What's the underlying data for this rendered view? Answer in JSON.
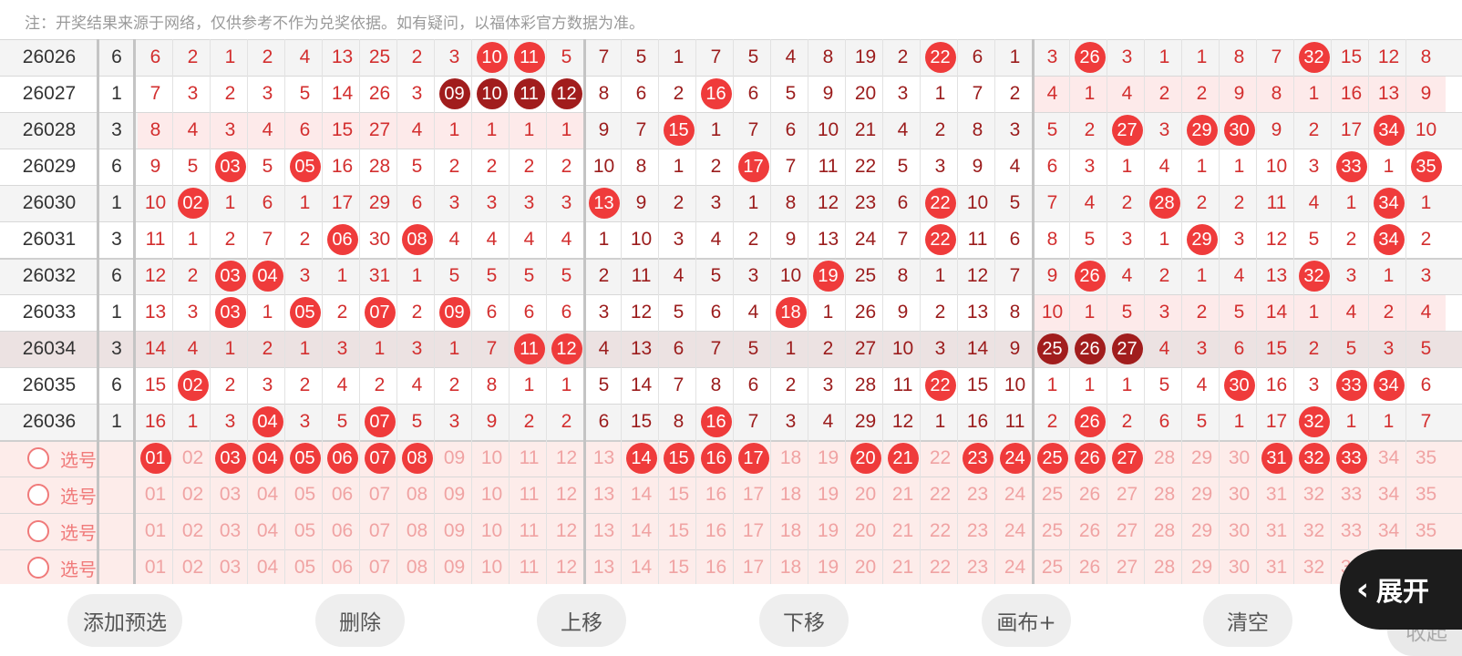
{
  "note": "注：开奖结果来源于网络，仅供参考不作为兑奖依据。如有疑问，以福体彩官方数据为准。",
  "rows": [
    {
      "issue": "26026",
      "sum": "6",
      "cells": [
        "6",
        "2",
        "1",
        "2",
        "4",
        "13",
        "25",
        "2",
        "3",
        "10",
        "11",
        "5",
        "7",
        "5",
        "1",
        "7",
        "5",
        "4",
        "8",
        "19",
        "2",
        "22",
        "6",
        "1",
        "3",
        "26",
        "3",
        "1",
        "1",
        "8",
        "7",
        "32",
        "15",
        "12",
        "8"
      ],
      "balls": [
        9,
        10,
        21,
        25,
        31
      ],
      "dark": []
    },
    {
      "issue": "26027",
      "sum": "1",
      "cells": [
        "7",
        "3",
        "2",
        "3",
        "5",
        "14",
        "26",
        "3",
        "09",
        "10",
        "11",
        "12",
        "8",
        "6",
        "2",
        "16",
        "6",
        "5",
        "9",
        "20",
        "3",
        "1",
        "7",
        "2",
        "4",
        "1",
        "4",
        "2",
        "2",
        "9",
        "8",
        "1",
        "16",
        "13",
        "9"
      ],
      "balls": [
        8,
        9,
        10,
        11,
        15
      ],
      "dark": [
        8,
        9,
        10,
        11
      ]
    },
    {
      "issue": "26028",
      "sum": "3",
      "cells": [
        "8",
        "4",
        "3",
        "4",
        "6",
        "15",
        "27",
        "4",
        "1",
        "1",
        "1",
        "1",
        "9",
        "7",
        "15",
        "1",
        "7",
        "6",
        "10",
        "21",
        "4",
        "2",
        "8",
        "3",
        "5",
        "2",
        "27",
        "3",
        "29",
        "30",
        "9",
        "2",
        "17",
        "34",
        "10"
      ],
      "balls": [
        14,
        26,
        28,
        29,
        33
      ],
      "dark": []
    },
    {
      "issue": "26029",
      "sum": "6",
      "cells": [
        "9",
        "5",
        "03",
        "5",
        "05",
        "16",
        "28",
        "5",
        "2",
        "2",
        "2",
        "2",
        "10",
        "8",
        "1",
        "2",
        "17",
        "7",
        "11",
        "22",
        "5",
        "3",
        "9",
        "4",
        "6",
        "3",
        "1",
        "4",
        "1",
        "1",
        "10",
        "3",
        "33",
        "1",
        "35"
      ],
      "balls": [
        2,
        4,
        16,
        32,
        34
      ],
      "dark": []
    },
    {
      "issue": "26030",
      "sum": "1",
      "cells": [
        "10",
        "02",
        "1",
        "6",
        "1",
        "17",
        "29",
        "6",
        "3",
        "3",
        "3",
        "3",
        "13",
        "9",
        "2",
        "3",
        "1",
        "8",
        "12",
        "23",
        "6",
        "22",
        "10",
        "5",
        "7",
        "4",
        "2",
        "28",
        "2",
        "2",
        "11",
        "4",
        "1",
        "34",
        "1"
      ],
      "balls": [
        1,
        12,
        21,
        27,
        33
      ],
      "dark": []
    },
    {
      "issue": "26031",
      "sum": "3",
      "cells": [
        "11",
        "1",
        "2",
        "7",
        "2",
        "06",
        "30",
        "08",
        "4",
        "4",
        "4",
        "4",
        "1",
        "10",
        "3",
        "4",
        "2",
        "9",
        "13",
        "24",
        "7",
        "22",
        "11",
        "6",
        "8",
        "5",
        "3",
        "1",
        "29",
        "3",
        "12",
        "5",
        "2",
        "34",
        "2"
      ],
      "balls": [
        5,
        7,
        21,
        28,
        33
      ],
      "dark": []
    },
    {
      "issue": "26032",
      "sum": "6",
      "cells": [
        "12",
        "2",
        "03",
        "04",
        "3",
        "1",
        "31",
        "1",
        "5",
        "5",
        "5",
        "5",
        "2",
        "11",
        "4",
        "5",
        "3",
        "10",
        "19",
        "25",
        "8",
        "1",
        "12",
        "7",
        "9",
        "26",
        "4",
        "2",
        "1",
        "4",
        "13",
        "32",
        "3",
        "1",
        "3"
      ],
      "balls": [
        2,
        3,
        18,
        25,
        31
      ],
      "dark": []
    },
    {
      "issue": "26033",
      "sum": "1",
      "cells": [
        "13",
        "3",
        "03",
        "1",
        "05",
        "2",
        "07",
        "2",
        "09",
        "6",
        "6",
        "6",
        "3",
        "12",
        "5",
        "6",
        "4",
        "18",
        "1",
        "26",
        "9",
        "2",
        "13",
        "8",
        "10",
        "1",
        "5",
        "3",
        "2",
        "5",
        "14",
        "1",
        "4",
        "2",
        "4"
      ],
      "balls": [
        2,
        4,
        6,
        8,
        17
      ],
      "dark": []
    },
    {
      "issue": "26034",
      "sum": "3",
      "cells": [
        "14",
        "4",
        "1",
        "2",
        "1",
        "3",
        "1",
        "3",
        "1",
        "7",
        "11",
        "12",
        "4",
        "13",
        "6",
        "7",
        "5",
        "1",
        "2",
        "27",
        "10",
        "3",
        "14",
        "9",
        "25",
        "26",
        "27",
        "4",
        "3",
        "6",
        "15",
        "2",
        "5",
        "3",
        "5"
      ],
      "balls": [
        10,
        11,
        24,
        25,
        26
      ],
      "dark": [
        24,
        25,
        26
      ]
    },
    {
      "issue": "26035",
      "sum": "6",
      "cells": [
        "15",
        "02",
        "2",
        "3",
        "2",
        "4",
        "2",
        "4",
        "2",
        "8",
        "1",
        "1",
        "5",
        "14",
        "7",
        "8",
        "6",
        "2",
        "3",
        "28",
        "11",
        "22",
        "15",
        "10",
        "1",
        "1",
        "1",
        "5",
        "4",
        "30",
        "16",
        "3",
        "33",
        "34",
        "6"
      ],
      "balls": [
        1,
        21,
        29,
        32,
        33
      ],
      "dark": []
    },
    {
      "issue": "26036",
      "sum": "1",
      "cells": [
        "16",
        "1",
        "3",
        "04",
        "3",
        "5",
        "07",
        "5",
        "3",
        "9",
        "2",
        "2",
        "6",
        "15",
        "8",
        "16",
        "7",
        "3",
        "4",
        "29",
        "12",
        "1",
        "16",
        "11",
        "2",
        "26",
        "2",
        "6",
        "5",
        "1",
        "17",
        "32",
        "1",
        "1",
        "7"
      ],
      "balls": [
        3,
        6,
        15,
        25,
        31
      ],
      "dark": []
    }
  ],
  "picks": {
    "label": "选号",
    "numbers": [
      "01",
      "02",
      "03",
      "04",
      "05",
      "06",
      "07",
      "08",
      "09",
      "10",
      "11",
      "12",
      "13",
      "14",
      "15",
      "16",
      "17",
      "18",
      "19",
      "20",
      "21",
      "22",
      "23",
      "24",
      "25",
      "26",
      "27",
      "28",
      "29",
      "30",
      "31",
      "32",
      "33",
      "34",
      "35"
    ],
    "rows": [
      {
        "selected": [
          0,
          2,
          3,
          4,
          5,
          6,
          7,
          13,
          14,
          15,
          16,
          19,
          20,
          22,
          23,
          24,
          25,
          26,
          30,
          31,
          32
        ]
      },
      {
        "selected": []
      },
      {
        "selected": []
      },
      {
        "selected": []
      }
    ]
  },
  "toolbar": {
    "add": "添加预选",
    "delete": "删除",
    "up": "上移",
    "down": "下移",
    "canvas": "画布+",
    "clear": "清空",
    "collapse": "收起",
    "expand": "展开"
  },
  "colors": {
    "ball": "#ef3b3b",
    "ball_dark": "#a11d1d",
    "pick_bg": "#fdecea"
  }
}
